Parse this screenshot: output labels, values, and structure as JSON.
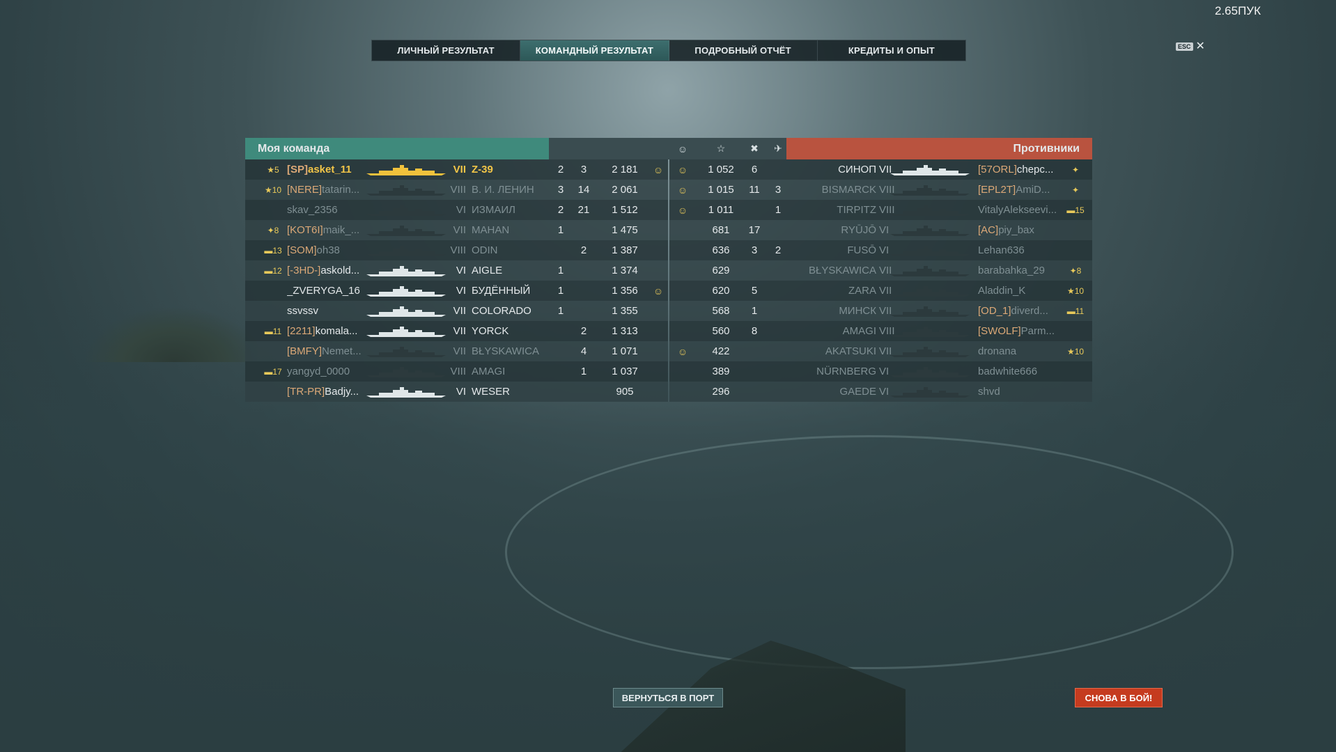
{
  "fps": "2.65ПУК",
  "tabs": [
    {
      "label": "ЛИЧНЫЙ РЕЗУЛЬТАТ"
    },
    {
      "label": "КОМАНДНЫЙ РЕЗУЛЬТАТ",
      "active": true
    },
    {
      "label": "ПОДРОБНЫЙ ОТЧЁТ"
    },
    {
      "label": "КРЕДИТЫ И ОПЫТ"
    }
  ],
  "esc": {
    "key": "ESC",
    "close": "✕"
  },
  "my_team": {
    "title": "Моя команда",
    "color": "#3f8a7c"
  },
  "enemy_team": {
    "title": "Противники",
    "color": "#b9533f"
  },
  "header_icons": {
    "planes": "plane-icon",
    "kills": "crossed-swords-icon",
    "xp": "star-icon",
    "achievements": "achievement-icon"
  },
  "left_rows": [
    {
      "medal": "★5",
      "tag": "[SP]",
      "name": "asket_11",
      "tier": "VII",
      "ship": "Z-39",
      "c1": "2",
      "c2": "3",
      "xp": "2 181",
      "ach": "☺",
      "player": true
    },
    {
      "medal": "★10",
      "tag": "[NERE]",
      "name": "tatarin...",
      "tier": "VIII",
      "ship": "В. И. ЛЕНИН",
      "c1": "3",
      "c2": "14",
      "xp": "2 061",
      "ach": "",
      "dead": true
    },
    {
      "medal": "",
      "tag": "",
      "name": "skav_2356",
      "tier": "VI",
      "ship": "ИЗМАИЛ",
      "c1": "2",
      "c2": "21",
      "xp": "1 512",
      "ach": "",
      "dead": true
    },
    {
      "medal": "✦8",
      "tag": "[KOT6I]",
      "name": "maik_...",
      "tier": "VII",
      "ship": "MAHAN",
      "c1": "1",
      "c2": "",
      "xp": "1 475",
      "ach": "",
      "dead": true
    },
    {
      "medal": "▬13",
      "tag": "[SOM]",
      "name": "oh38",
      "tier": "VIII",
      "ship": "ODIN",
      "c1": "",
      "c2": "2",
      "xp": "1 387",
      "ach": "",
      "dead": true
    },
    {
      "medal": "▬12",
      "tag": "[-3HD-]",
      "name": "askold...",
      "tier": "VI",
      "ship": "AIGLE",
      "c1": "1",
      "c2": "",
      "xp": "1 374",
      "ach": ""
    },
    {
      "medal": "",
      "tag": "",
      "name": "_ZVERYGA_16",
      "tier": "VI",
      "ship": "БУДЁННЫЙ",
      "c1": "1",
      "c2": "",
      "xp": "1 356",
      "ach": "☺"
    },
    {
      "medal": "",
      "tag": "",
      "name": "ssvssv",
      "tier": "VII",
      "ship": "COLORADO",
      "c1": "1",
      "c2": "",
      "xp": "1 355",
      "ach": ""
    },
    {
      "medal": "▬11",
      "tag": "[2211]",
      "name": "komala...",
      "tier": "VII",
      "ship": "YORCK",
      "c1": "",
      "c2": "2",
      "xp": "1 313",
      "ach": ""
    },
    {
      "medal": "",
      "tag": "[BMFY]",
      "name": "Nemet...",
      "tier": "VII",
      "ship": "BŁYSKAWICA",
      "c1": "",
      "c2": "4",
      "xp": "1 071",
      "ach": "",
      "dead": true
    },
    {
      "medal": "▬17",
      "tag": "",
      "name": "yangyd_0000",
      "tier": "VIII",
      "ship": "AMAGI",
      "c1": "",
      "c2": "1",
      "xp": "1 037",
      "ach": "",
      "dead": true
    },
    {
      "medal": "",
      "tag": "[TR-PR]",
      "name": "Badjy...",
      "tier": "VI",
      "ship": "WESER",
      "c1": "",
      "c2": "",
      "xp": "905",
      "ach": ""
    }
  ],
  "right_rows": [
    {
      "ach": "☺",
      "xp": "1 052",
      "c1": "6",
      "c2": "",
      "ship": "СИНОП",
      "tier": "VII",
      "tag": "[57ORL]",
      "name": "chepc...",
      "medal": "✦"
    },
    {
      "ach": "☺",
      "xp": "1 015",
      "c1": "11",
      "c2": "3",
      "ship": "BISMARCK",
      "tier": "VIII",
      "tag": "[EPL2T]",
      "name": "AmiD...",
      "medal": "✦",
      "dead": true
    },
    {
      "ach": "☺",
      "xp": "1 011",
      "c1": "",
      "c2": "1",
      "ship": "TIRPITZ",
      "tier": "VIII",
      "tag": "",
      "name": "VitalyAlekseevi...",
      "medal": "▬15",
      "dead": true
    },
    {
      "ach": "",
      "xp": "681",
      "c1": "17",
      "c2": "",
      "ship": "RYŪJŌ",
      "tier": "VI",
      "tag": "[AC]",
      "name": "piy_bax",
      "medal": "",
      "dead": true
    },
    {
      "ach": "",
      "xp": "636",
      "c1": "3",
      "c2": "2",
      "ship": "FUSŌ",
      "tier": "VI",
      "tag": "",
      "name": "Lehan636",
      "medal": "",
      "dead": true
    },
    {
      "ach": "",
      "xp": "629",
      "c1": "",
      "c2": "",
      "ship": "BŁYSKAWICA",
      "tier": "VII",
      "tag": "",
      "name": "barabahka_29",
      "medal": "✦8",
      "dead": true
    },
    {
      "ach": "",
      "xp": "620",
      "c1": "5",
      "c2": "",
      "ship": "ZARA",
      "tier": "VII",
      "tag": "",
      "name": "Aladdin_K",
      "medal": "★10",
      "dead": true
    },
    {
      "ach": "",
      "xp": "568",
      "c1": "1",
      "c2": "",
      "ship": "МИНСК",
      "tier": "VII",
      "tag": "[OD_1]",
      "name": "diverd...",
      "medal": "▬11",
      "dead": true
    },
    {
      "ach": "",
      "xp": "560",
      "c1": "8",
      "c2": "",
      "ship": "AMAGI",
      "tier": "VIII",
      "tag": "[SWOLF]",
      "name": "Parm...",
      "medal": "",
      "dead": true
    },
    {
      "ach": "☺",
      "xp": "422",
      "c1": "",
      "c2": "",
      "ship": "AKATSUKI",
      "tier": "VII",
      "tag": "",
      "name": "dronana",
      "medal": "★10",
      "dead": true
    },
    {
      "ach": "",
      "xp": "389",
      "c1": "",
      "c2": "",
      "ship": "NÜRNBERG",
      "tier": "VI",
      "tag": "",
      "name": "badwhite666",
      "medal": "",
      "dead": true
    },
    {
      "ach": "",
      "xp": "296",
      "c1": "",
      "c2": "",
      "ship": "GAEDE",
      "tier": "VI",
      "tag": "",
      "name": "shvd",
      "medal": "",
      "dead": true
    }
  ],
  "buttons": {
    "port": "ВЕРНУТЬСЯ В ПОРТ",
    "battle": "СНОВА В БОЙ!"
  }
}
